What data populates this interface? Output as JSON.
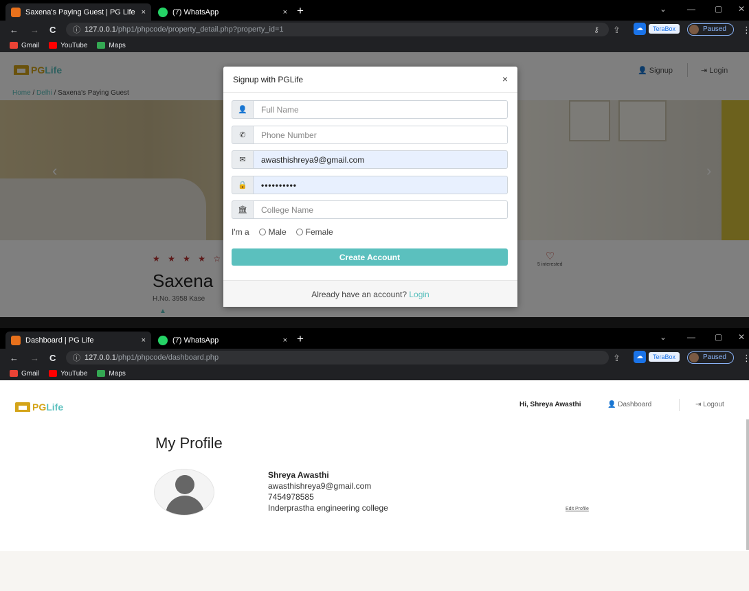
{
  "screen1": {
    "tabs": [
      {
        "title": "Saxena's Paying Guest | PG Life",
        "close": "×"
      },
      {
        "title": "(7) WhatsApp",
        "close": "×"
      }
    ],
    "new_tab": "+",
    "url_host": "127.0.0.1",
    "url_path": "/php1/phpcode/property_detail.php?property_id=1",
    "terabox": "TeraBox",
    "paused": "Paused",
    "bookmarks": [
      "Gmail",
      "YouTube",
      "Maps"
    ],
    "logo": {
      "pg": "PG",
      "life": "Life"
    },
    "nav": {
      "signup": "Signup",
      "login": "Login"
    },
    "breadcrumb": {
      "home": "Home",
      "city": "Delhi",
      "current": "Saxena's Paying Guest",
      "sep": "/"
    },
    "stars": "★ ★ ★ ★ ☆",
    "interested": "5 interested",
    "property_name": "Saxena",
    "property_address": "H.No. 3958 Kase",
    "modal": {
      "title": "Signup with PGLife",
      "close": "×",
      "full_name_placeholder": "Full Name",
      "phone_placeholder": "Phone Number",
      "email_value": "awasthishreya9@gmail.com",
      "password_value": "••••••••••",
      "college_placeholder": "College Name",
      "gender_label": "I'm a",
      "male": "Male",
      "female": "Female",
      "create_button": "Create Account",
      "footer_text": "Already have an account?",
      "footer_link": "Login"
    }
  },
  "screen2": {
    "tabs": [
      {
        "title": "Dashboard | PG Life",
        "close": "×"
      },
      {
        "title": "(7) WhatsApp",
        "close": "×"
      }
    ],
    "new_tab": "+",
    "url_host": "127.0.0.1",
    "url_path": "/php1/phpcode/dashboard.php",
    "terabox": "TeraBox",
    "paused": "Paused",
    "bookmarks": [
      "Gmail",
      "YouTube",
      "Maps"
    ],
    "logo": {
      "pg": "PG",
      "life": "Life"
    },
    "greeting": "Hi, Shreya Awasthi",
    "nav": {
      "dashboard": "Dashboard",
      "logout": "Logout"
    },
    "page_title": "My Profile",
    "profile": {
      "name": "Shreya Awasthi",
      "email": "awasthishreya9@gmail.com",
      "phone": "7454978585",
      "college": "Inderprastha engineering college",
      "edit": "Edit Profile"
    }
  },
  "colors": {
    "accent": "#5bc0be",
    "logo_gold": "#d4a419",
    "heart": "#c0392b"
  }
}
